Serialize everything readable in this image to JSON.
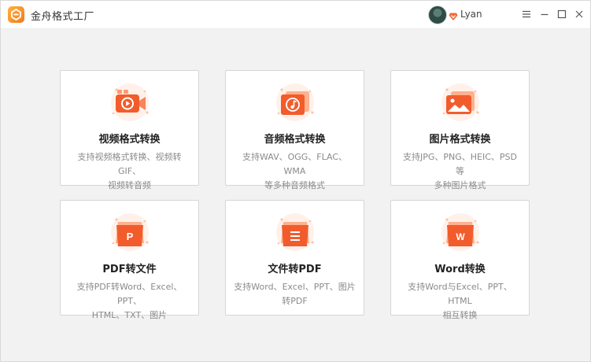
{
  "app": {
    "title": "金舟格式工厂"
  },
  "user": {
    "name": "Lyan"
  },
  "window_controls": [
    "menu-icon",
    "minimize-icon",
    "maximize-icon",
    "close-icon"
  ],
  "colors": {
    "accent": "#f25c2c",
    "accent_light": "#ffb08c",
    "background": "#f2f2f2",
    "card": "#ffffff"
  },
  "cards": [
    {
      "title": "视频格式转换",
      "desc": [
        "支持视频格式转换、视频转GIF、",
        "视频转音频"
      ],
      "icon": "video-icon"
    },
    {
      "title": "音频格式转换",
      "desc": [
        "支持WAV、OGG、FLAC、WMA",
        "等多种音频格式"
      ],
      "icon": "audio-icon"
    },
    {
      "title": "图片格式转换",
      "desc": [
        "支持JPG、PNG、HEIC、PSD等",
        "多种图片格式"
      ],
      "icon": "image-icon"
    },
    {
      "title": "PDF转文件",
      "desc": [
        "支持PDF转Word、Excel、PPT、",
        "HTML、TXT、图片"
      ],
      "icon": "pdf-to-file-icon"
    },
    {
      "title": "文件转PDF",
      "desc": [
        "支持Word、Excel、PPT、图片",
        "转PDF"
      ],
      "icon": "file-to-pdf-icon"
    },
    {
      "title": "Word转换",
      "desc": [
        "支持Word与Excel、PPT、HTML",
        "相互转换"
      ],
      "icon": "word-convert-icon"
    }
  ]
}
